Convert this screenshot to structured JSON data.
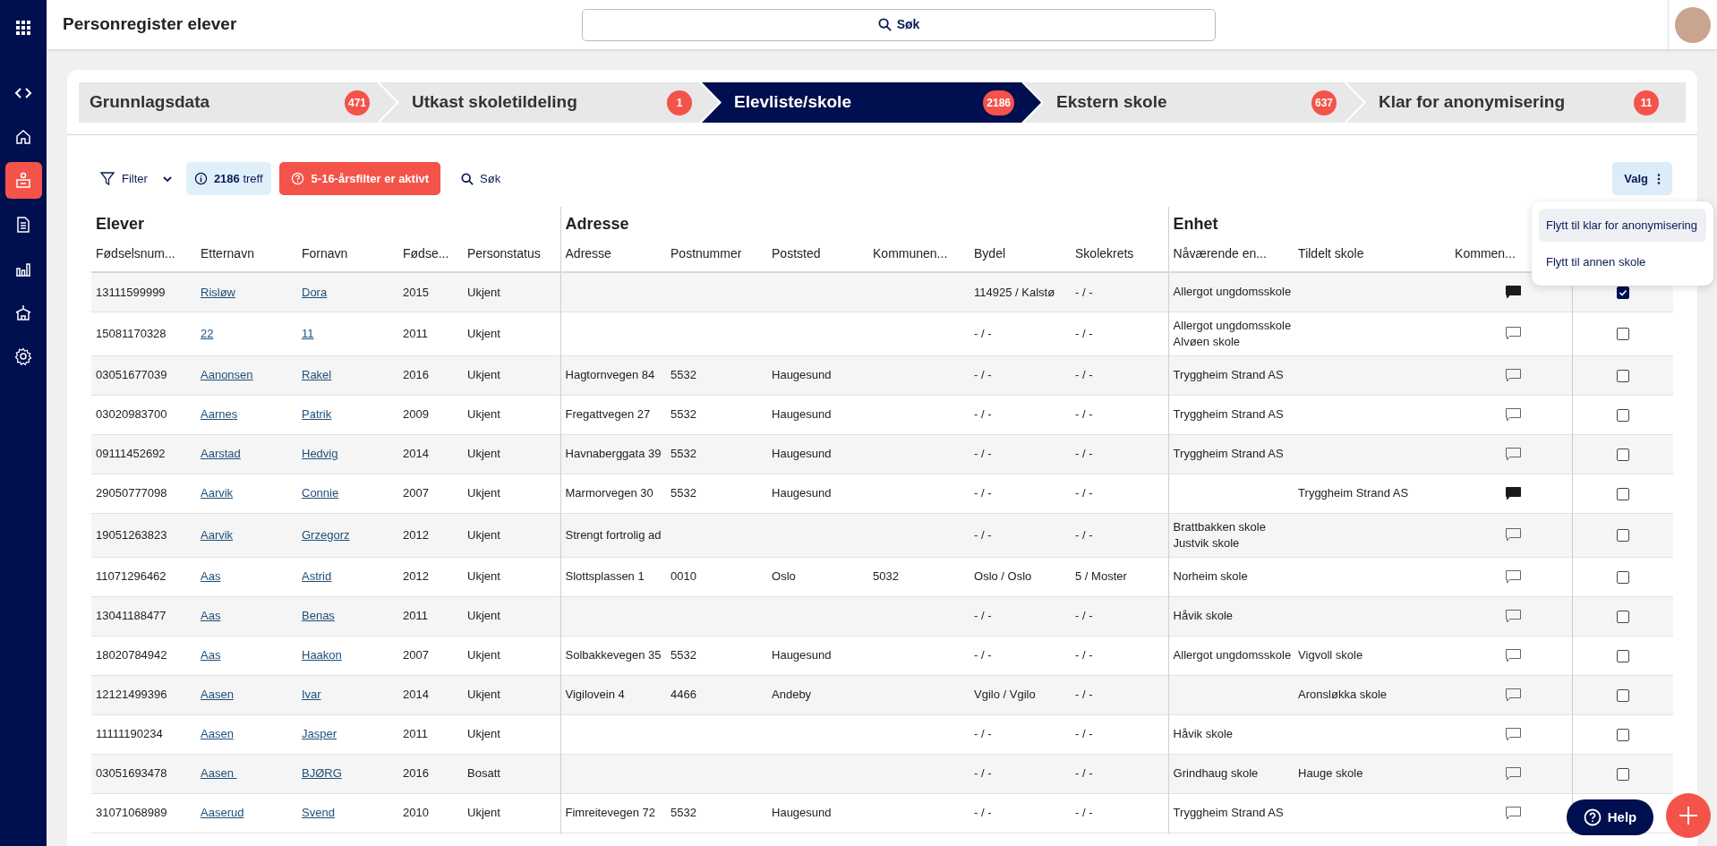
{
  "app_title": "Personregister elever",
  "search": {
    "label": "Søk"
  },
  "sidebar": {
    "items": [
      {
        "kind": "apps",
        "selected": false
      },
      {
        "kind": "code",
        "selected": false
      },
      {
        "kind": "home",
        "selected": false
      },
      {
        "kind": "desk",
        "selected": true
      },
      {
        "kind": "document",
        "selected": false
      },
      {
        "kind": "chart",
        "selected": false
      },
      {
        "kind": "school",
        "selected": false
      },
      {
        "kind": "settings",
        "selected": false
      }
    ]
  },
  "steps": [
    {
      "label": "Grunnlagsdata",
      "count": "471",
      "selected": false
    },
    {
      "label": "Utkast skoletildeling",
      "count": "1",
      "selected": false
    },
    {
      "label": "Elevliste/skole",
      "count": "2186",
      "selected": true
    },
    {
      "label": "Ekstern skole",
      "count": "637",
      "selected": false
    },
    {
      "label": "Klar for anonymisering",
      "count": "11",
      "selected": false
    }
  ],
  "toolbar": {
    "filter": "Filter",
    "hits_count": "2186",
    "hits_label": "treff",
    "age_filter": "5-16-årsfilter er aktivt",
    "search": "Søk",
    "options": "Valg"
  },
  "options_menu": [
    {
      "label": "Flytt til klar for anonymisering",
      "highlighted": true
    },
    {
      "label": "Flytt til annen skole",
      "highlighted": false
    }
  ],
  "table": {
    "groups": [
      {
        "title": "Elever",
        "columns": [
          "Fødselsnum...",
          "Etternavn",
          "Fornavn",
          "Fødse...",
          "Personstatus"
        ]
      },
      {
        "title": "Adresse",
        "columns": [
          "Adresse",
          "Postnummer",
          "Poststed",
          "Kommunen...",
          "Bydel",
          "Skolekrets"
        ]
      },
      {
        "title": "Enhet",
        "columns": [
          "Nåværende en...",
          "Tildelt skole",
          "Kommen..."
        ]
      }
    ],
    "rows": [
      {
        "fodselsnummer": "13111599999",
        "etternavn": "Risløw",
        "fornavn": "Dora",
        "fodselsar": "2015",
        "personstatus": "Ukjent",
        "bydel": "114925 / Kalstø",
        "skolekrets": "- / -",
        "navaerende_enhet": [
          "Allergot ungdomsskole"
        ],
        "has_comment": true,
        "selected": true
      },
      {
        "fodselsnummer": "15081170328",
        "etternavn": "22",
        "fornavn": "11",
        "fodselsar": "2011",
        "personstatus": "Ukjent",
        "bydel": "- / -",
        "skolekrets": "- / -",
        "navaerende_enhet": [
          "Allergot ungdomsskole",
          "Alvøen skole"
        ],
        "has_comment": false,
        "selected": false
      },
      {
        "fodselsnummer": "03051677039",
        "etternavn": "Aanonsen",
        "fornavn": "Rakel",
        "fodselsar": "2016",
        "personstatus": "Ukjent",
        "adresse": "Hagtornvegen 84",
        "postnummer": "5532",
        "poststed": "Haugesund",
        "bydel": "- / -",
        "skolekrets": "- / -",
        "navaerende_enhet": [
          "Tryggheim Strand AS"
        ],
        "has_comment": false,
        "selected": false
      },
      {
        "fodselsnummer": "03020983700",
        "etternavn": "Aarnes",
        "fornavn": "Patrik",
        "fodselsar": "2009",
        "personstatus": "Ukjent",
        "adresse": "Fregattvegen 27",
        "postnummer": "5532",
        "poststed": "Haugesund",
        "bydel": "- / -",
        "skolekrets": "- / -",
        "navaerende_enhet": [
          "Tryggheim Strand AS"
        ],
        "has_comment": false,
        "selected": false
      },
      {
        "fodselsnummer": "09111452692",
        "etternavn": "Aarstad",
        "fornavn": "Hedvig",
        "fodselsar": "2014",
        "personstatus": "Ukjent",
        "adresse": "Havnaberggata 39",
        "postnummer": "5532",
        "poststed": "Haugesund",
        "bydel": "- / -",
        "skolekrets": "- / -",
        "navaerende_enhet": [
          "Tryggheim Strand AS"
        ],
        "has_comment": false,
        "selected": false
      },
      {
        "fodselsnummer": "29050777098",
        "etternavn": "Aarvik",
        "fornavn": "Connie",
        "fodselsar": "2007",
        "personstatus": "Ukjent",
        "adresse": "Marmorvegen 30",
        "postnummer": "5532",
        "poststed": "Haugesund",
        "bydel": "- / -",
        "skolekrets": "- / -",
        "tildelt_skole": "Tryggheim Strand AS",
        "has_comment": true,
        "selected": false
      },
      {
        "fodselsnummer": "19051263823",
        "etternavn": "Aarvik",
        "fornavn": "Grzegorz",
        "fodselsar": "2012",
        "personstatus": "Ukjent",
        "adresse": "Strengt fortrolig ad",
        "bydel": "- / -",
        "skolekrets": "- / -",
        "navaerende_enhet": [
          "Brattbakken skole",
          "Justvik skole"
        ],
        "has_comment": false,
        "selected": false
      },
      {
        "fodselsnummer": "11071296462",
        "etternavn": "Aas",
        "fornavn": "Astrid",
        "fodselsar": "2012",
        "personstatus": "Ukjent",
        "adresse": "Slottsplassen 1",
        "postnummer": "0010",
        "poststed": "Oslo",
        "kommunenr": "5032",
        "bydel": "Oslo / Oslo",
        "skolekrets": "5 / Moster",
        "navaerende_enhet": [
          "Norheim skole"
        ],
        "has_comment": false,
        "selected": false
      },
      {
        "fodselsnummer": "13041188477",
        "etternavn": "Aas",
        "fornavn": "Benas",
        "fodselsar": "2011",
        "personstatus": "Ukjent",
        "bydel": "- / -",
        "skolekrets": "- / -",
        "navaerende_enhet": [
          "Håvik skole"
        ],
        "has_comment": false,
        "selected": false
      },
      {
        "fodselsnummer": "18020784942",
        "etternavn": "Aas",
        "fornavn": "Haakon",
        "fodselsar": "2007",
        "personstatus": "Ukjent",
        "adresse": "Solbakkevegen 35",
        "postnummer": "5532",
        "poststed": "Haugesund",
        "bydel": "- / -",
        "skolekrets": "- / -",
        "navaerende_enhet": [
          "Allergot ungdomsskole"
        ],
        "tildelt_skole": "Vigvoll skole",
        "has_comment": false,
        "selected": false
      },
      {
        "fodselsnummer": "12121499396",
        "etternavn": "Aasen",
        "fornavn": "Ivar",
        "fodselsar": "2014",
        "personstatus": "Ukjent",
        "adresse": "Vigilovein 4",
        "postnummer": "4466",
        "poststed": "Andeby",
        "bydel": "Vgilo / Vgilo",
        "skolekrets": "- / -",
        "tildelt_skole": "Aronsløkka skole",
        "has_comment": false,
        "selected": false
      },
      {
        "fodselsnummer": "11111190234",
        "etternavn": "Aasen",
        "fornavn": "Jasper",
        "fodselsar": "2011",
        "personstatus": "Ukjent",
        "bydel": "- / -",
        "skolekrets": "- / -",
        "navaerende_enhet": [
          "Håvik skole"
        ],
        "has_comment": false,
        "selected": false
      },
      {
        "fodselsnummer": "03051693478",
        "etternavn": "Aasen ",
        "fornavn": "BJØRG",
        "fodselsar": "2016",
        "personstatus": "Bosatt",
        "bydel": "- / -",
        "skolekrets": "- / -",
        "navaerende_enhet": [
          "Grindhaug skole"
        ],
        "tildelt_skole": "Hauge skole",
        "has_comment": false,
        "selected": false
      },
      {
        "fodselsnummer": "31071068989",
        "etternavn": "Aaserud",
        "fornavn": "Svend",
        "fodselsar": "2010",
        "personstatus": "Ukjent",
        "adresse": "Fimreitevegen 72",
        "postnummer": "5532",
        "poststed": "Haugesund",
        "bydel": "- / -",
        "skolekrets": "- / -",
        "navaerende_enhet": [
          "Tryggheim Strand AS"
        ],
        "has_comment": false
      }
    ]
  },
  "help_button": "Help"
}
